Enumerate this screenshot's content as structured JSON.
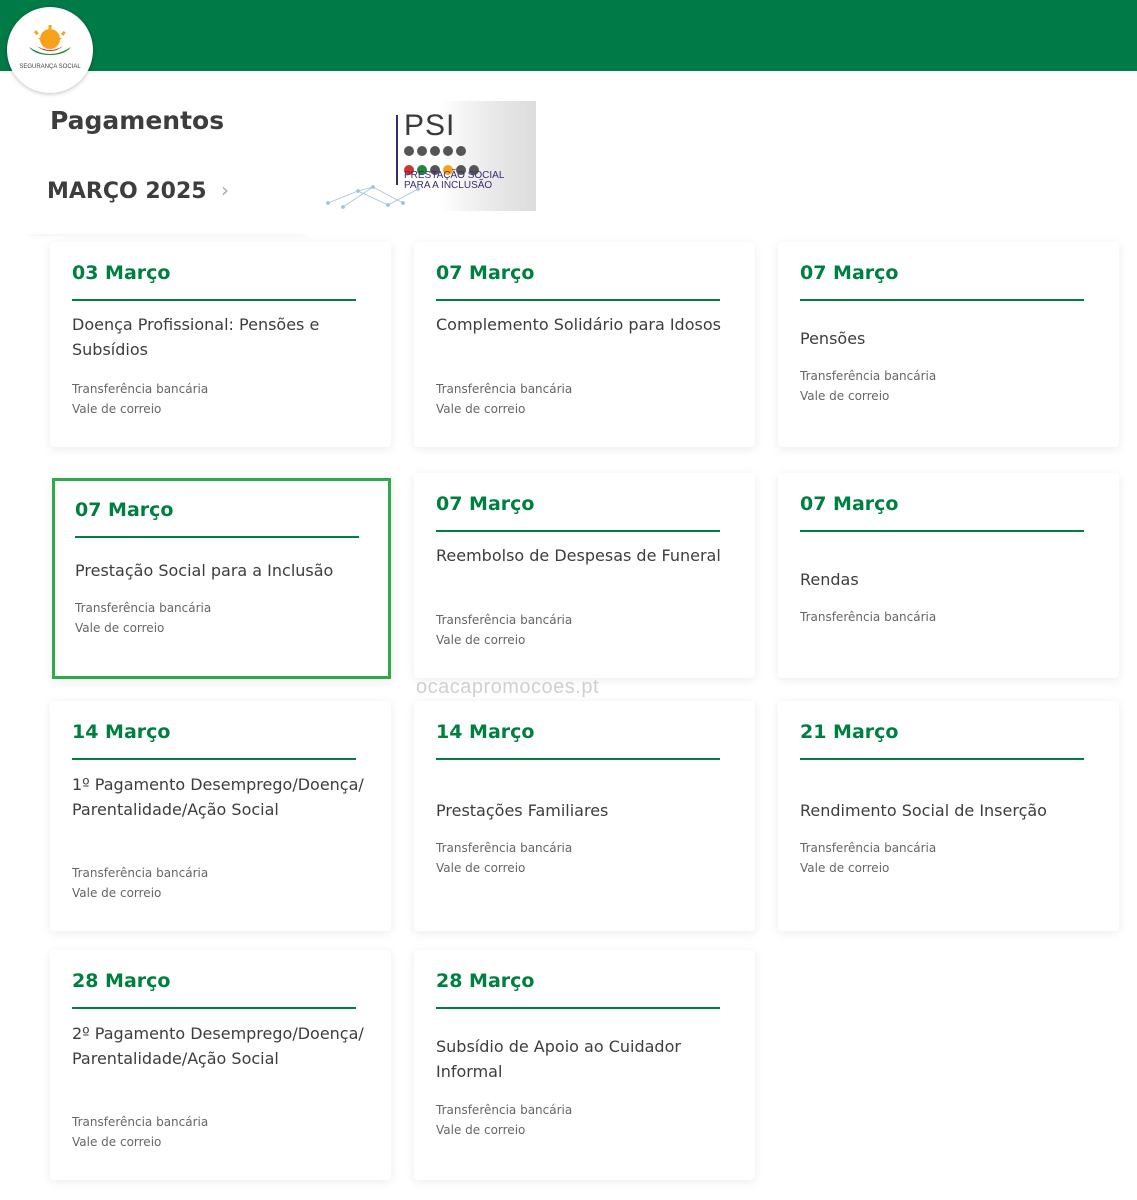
{
  "brand": {
    "logo_text": "SEGURANÇA SOCIAL"
  },
  "page": {
    "title": "Pagamentos",
    "month": "MARÇO 2025",
    "next_month_icon": "chevron-right-icon"
  },
  "banner": {
    "title": "PSI",
    "subtitle_line1": "PRESTAÇÃO SOCIAL",
    "subtitle_line2": "PARA A INCLUSÃO"
  },
  "payments": [
    {
      "date": "03 Março",
      "title": "Doença Profissional: Pensões e Subsídios",
      "methods": [
        "Transferência bancária",
        "Vale de correio"
      ]
    },
    {
      "date": "07 Março",
      "title": "Complemento Solidário para Idosos",
      "methods": [
        "Transferência bancária",
        "Vale de correio"
      ]
    },
    {
      "date": "07 Março",
      "title": "Pensões",
      "methods": [
        "Transferência bancária",
        "Vale de correio"
      ]
    },
    {
      "date": "07 Março",
      "title": "Prestação Social para a Inclusão",
      "methods": [
        "Transferência bancária",
        "Vale de correio"
      ],
      "selected": true
    },
    {
      "date": "07 Março",
      "title": "Reembolso de Despesas de Funeral",
      "methods": [
        "Transferência bancária",
        "Vale de correio"
      ]
    },
    {
      "date": "07 Março",
      "title": "Rendas",
      "methods": [
        "Transferência bancária"
      ]
    },
    {
      "date": "14 Março",
      "title": "1º Pagamento Desemprego/Doença/ Parentalidade/Ação Social",
      "methods": [
        "Transferência bancária",
        "Vale de correio"
      ]
    },
    {
      "date": "14 Março",
      "title": "Prestações Familiares",
      "methods": [
        "Transferência bancária",
        "Vale de correio"
      ]
    },
    {
      "date": "21 Março",
      "title": "Rendimento Social de Inserção",
      "methods": [
        "Transferência bancária",
        "Vale de correio"
      ]
    },
    {
      "date": "28 Março",
      "title": "2º Pagamento Desemprego/Doença/ Parentalidade/Ação Social",
      "methods": [
        "Transferência bancária",
        "Vale de correio"
      ]
    },
    {
      "date": "28 Março",
      "title": "Subsídio de Apoio ao Cuidador Informal",
      "methods": [
        "Transferência bancária",
        "Vale de correio"
      ]
    }
  ],
  "watermark": "ocacapromocoes.pt",
  "colors": {
    "header": "#007a46",
    "accent": "#008040",
    "selected_border": "#2eaa4b"
  }
}
